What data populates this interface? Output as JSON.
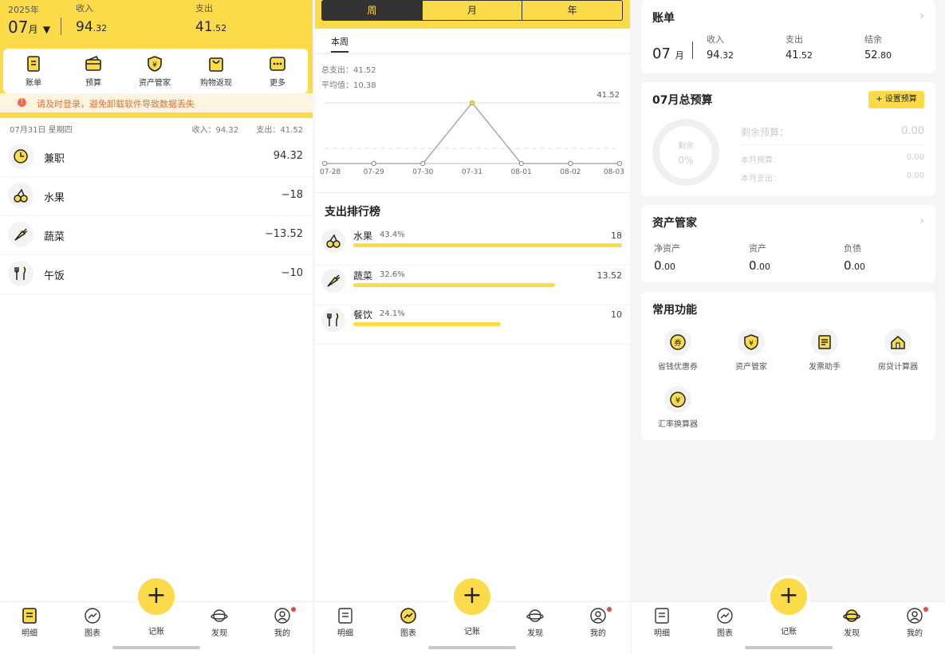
{
  "colors": {
    "accent": "#fcdb4b",
    "text": "#222222",
    "muted": "#777777",
    "warn": "#e0702a",
    "reddot": "#f04545"
  },
  "panel1": {
    "year": "2025年",
    "month_num": "07",
    "month_unit": "月",
    "month_caret": "▼",
    "income_label": "收入",
    "income_int": "94",
    "income_dec": ".32",
    "expense_label": "支出",
    "expense_int": "41",
    "expense_dec": ".52",
    "quick": [
      {
        "label": "账单",
        "icon": "bill-icon"
      },
      {
        "label": "预算",
        "icon": "wallet-icon"
      },
      {
        "label": "资产管家",
        "icon": "shield-yen-icon"
      },
      {
        "label": "购物返现",
        "icon": "shopping-bag-icon"
      },
      {
        "label": "更多",
        "icon": "more-icon"
      }
    ],
    "warn_icon": "!",
    "warning": "请及时登录，避免卸载软件导致数据丢失",
    "day": {
      "date": "07月31日 星期四",
      "income": "收入：94.32",
      "expense": "支出：41.52"
    },
    "rows": [
      {
        "name": "兼职",
        "amount": "94.32",
        "icon": "part-time-clock-icon"
      },
      {
        "name": "水果",
        "amount": "−18",
        "icon": "cherry-icon"
      },
      {
        "name": "蔬菜",
        "amount": "−13.52",
        "icon": "carrot-icon"
      },
      {
        "name": "午饭",
        "amount": "−10",
        "icon": "fork-knife-icon"
      }
    ]
  },
  "panel2": {
    "segments": [
      "周",
      "月",
      "年"
    ],
    "active_segment": "周",
    "tab": "本周",
    "total": "总支出：41.52",
    "average": "平均值：10.38",
    "rank_title": "支出排行榜",
    "rows": [
      {
        "name": "水果",
        "pct": "43.4%",
        "amount": "18",
        "icon": "cherry-icon",
        "fraction": 1.0
      },
      {
        "name": "蔬菜",
        "pct": "32.6%",
        "amount": "13.52",
        "icon": "carrot-icon",
        "fraction": 0.75
      },
      {
        "name": "餐饮",
        "pct": "24.1%",
        "amount": "10",
        "icon": "fork-knife-icon",
        "fraction": 0.55
      }
    ]
  },
  "chart_data": {
    "type": "line",
    "x": [
      "07-28",
      "07-29",
      "07-30",
      "07-31",
      "08-01",
      "08-02",
      "08-03"
    ],
    "series": [
      {
        "values": [
          0,
          0,
          0,
          41.52,
          0,
          0,
          0
        ]
      }
    ],
    "max_label": "41.52",
    "average": 10.38,
    "ylim": [
      0,
      41.52
    ],
    "grid": false
  },
  "panel3": {
    "bill": {
      "title": "账单",
      "chevron": "›",
      "month_num": "07",
      "month_unit": "月",
      "income_label": "收入",
      "income_int": "94",
      "income_dec": ".32",
      "expense_label": "支出",
      "expense_int": "41",
      "expense_dec": ".52",
      "balance_label": "结余",
      "balance_int": "52",
      "balance_dec": ".80"
    },
    "budget": {
      "title": "07月总预算",
      "button": "+ 设置预算",
      "ring_label": "剩余",
      "ring_value": "0%",
      "remaining_label": "剩余预算：",
      "remaining_value": "0.00",
      "month_budget_label": "本月预算：",
      "month_budget_value": "0.00",
      "month_spent_label": "本月支出：",
      "month_spent_value": "0.00"
    },
    "assets": {
      "title": "资产管家",
      "chevron": "›",
      "net_label": "净资产",
      "net_int": "0",
      "net_dec": ".00",
      "asset_label": "资产",
      "asset_int": "0",
      "asset_dec": ".00",
      "debt_label": "负债",
      "debt_int": "0",
      "debt_dec": ".00"
    },
    "tools": {
      "title": "常用功能",
      "items": [
        {
          "label": "省钱优惠券",
          "icon": "coupon-icon"
        },
        {
          "label": "资产管家",
          "icon": "shield-yen-icon"
        },
        {
          "label": "发票助手",
          "icon": "invoice-icon"
        },
        {
          "label": "房贷计算器",
          "icon": "house-loan-icon"
        },
        {
          "label": "汇率换算器",
          "icon": "currency-exchange-icon"
        }
      ]
    }
  },
  "nav": {
    "items": [
      "明细",
      "图表",
      "记账",
      "发现",
      "我的"
    ],
    "fab_symbol": "+"
  }
}
